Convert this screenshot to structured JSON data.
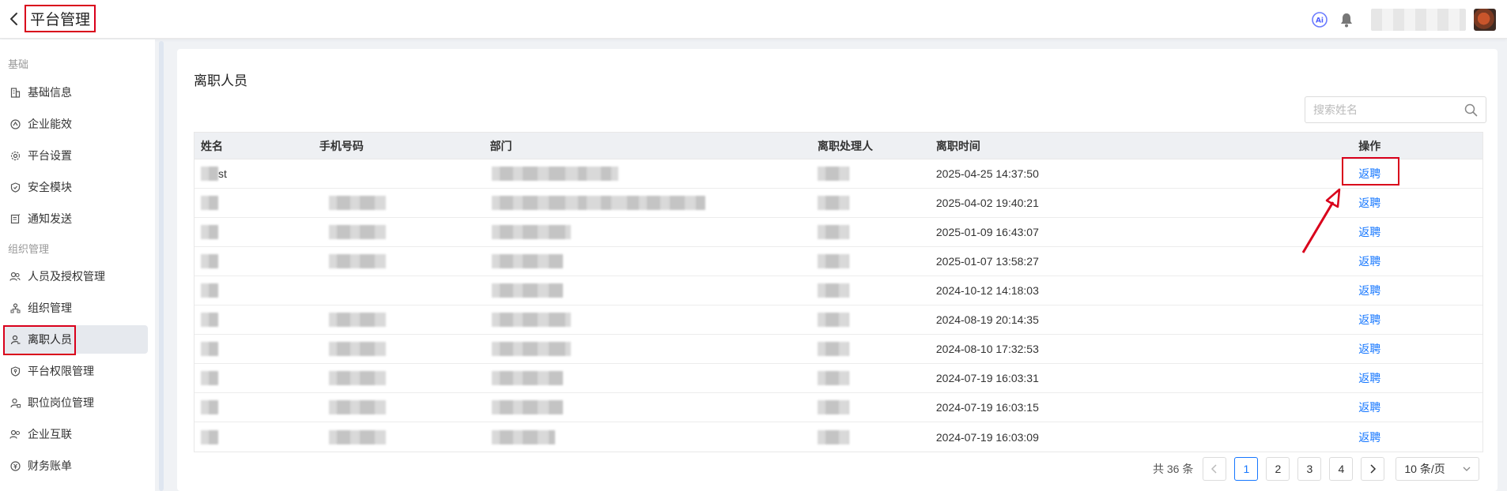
{
  "header": {
    "title": "平台管理"
  },
  "sidebar": {
    "groups": [
      {
        "title": "基础",
        "items": [
          {
            "label": "基础信息",
            "icon": "building-icon"
          },
          {
            "label": "企业能效",
            "icon": "gauge-icon"
          },
          {
            "label": "平台设置",
            "icon": "gear-icon"
          },
          {
            "label": "安全模块",
            "icon": "shield-icon"
          },
          {
            "label": "通知发送",
            "icon": "notice-icon"
          }
        ]
      },
      {
        "title": "组织管理",
        "items": [
          {
            "label": "人员及授权管理",
            "icon": "users-icon"
          },
          {
            "label": "组织管理",
            "icon": "org-icon"
          },
          {
            "label": "离职人员",
            "icon": "user-leave-icon",
            "active": true
          },
          {
            "label": "平台权限管理",
            "icon": "shield-key-icon"
          },
          {
            "label": "职位岗位管理",
            "icon": "user-badge-icon"
          },
          {
            "label": "企业互联",
            "icon": "link-users-icon"
          },
          {
            "label": "财务账单",
            "icon": "coin-icon"
          }
        ]
      }
    ]
  },
  "main": {
    "title": "离职人员",
    "search": {
      "placeholder": "搜索姓名",
      "value": ""
    },
    "table": {
      "columns": [
        "姓名",
        "手机号码",
        "部门",
        "离职处理人",
        "离职时间",
        "操作"
      ],
      "rows": [
        {
          "name": "st",
          "handler": "",
          "time": "2025-04-25 14:37:50",
          "action": "返聘"
        },
        {
          "name": "",
          "handler": "",
          "time": "2025-04-02 19:40:21",
          "action": "返聘"
        },
        {
          "name": "",
          "handler": "",
          "time": "2025-01-09 16:43:07",
          "action": "返聘"
        },
        {
          "name": "",
          "handler": "",
          "time": "2025-01-07 13:58:27",
          "action": "返聘"
        },
        {
          "name": "",
          "handler": "",
          "time": "2024-10-12 14:18:03",
          "action": "返聘"
        },
        {
          "name": "",
          "handler": "",
          "time": "2024-08-19 20:14:35",
          "action": "返聘"
        },
        {
          "name": "",
          "handler": "",
          "time": "2024-08-10 17:32:53",
          "action": "返聘"
        },
        {
          "name": "",
          "handler": "",
          "time": "2024-07-19 16:03:31",
          "action": "返聘"
        },
        {
          "name": "",
          "handler": "",
          "time": "2024-07-19 16:03:15",
          "action": "返聘"
        },
        {
          "name": "",
          "handler": "",
          "time": "2024-07-19 16:03:09",
          "action": "返聘"
        }
      ]
    },
    "pagination": {
      "total_label": "共 36 条",
      "pages": [
        "1",
        "2",
        "3",
        "4"
      ],
      "current_page": 1,
      "page_size_label": "10 条/页"
    }
  },
  "colors": {
    "accent": "#1677ff",
    "annotation_red": "#d9001b"
  }
}
